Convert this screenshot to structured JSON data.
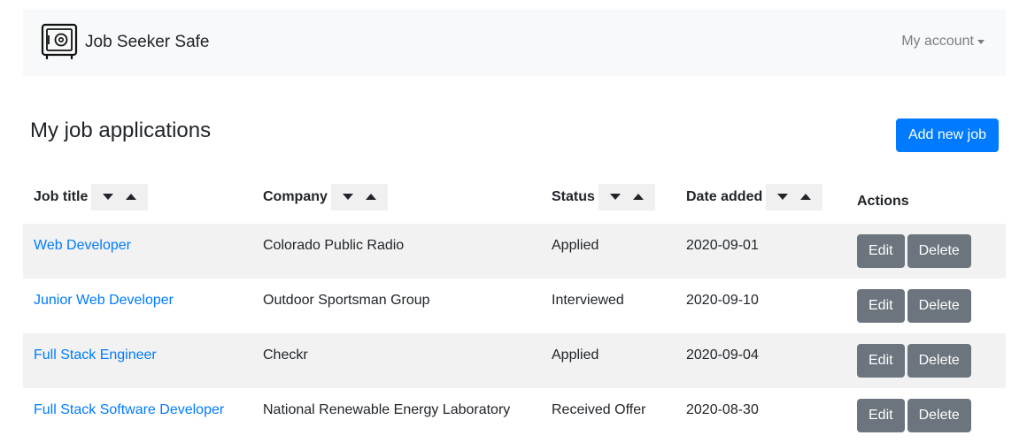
{
  "navbar": {
    "brand_name": "Job Seeker Safe",
    "brand_icon": "safe-icon",
    "account_label": "My account"
  },
  "page": {
    "title": "My job applications",
    "add_button_label": "Add new job"
  },
  "table": {
    "columns": [
      {
        "label": "Job title",
        "sortable": true
      },
      {
        "label": "Company",
        "sortable": true
      },
      {
        "label": "Status",
        "sortable": true
      },
      {
        "label": "Date added",
        "sortable": true
      },
      {
        "label": "Actions",
        "sortable": false
      }
    ],
    "sort_icons": {
      "down": "sort-down-icon",
      "up": "sort-up-icon"
    },
    "rows": [
      {
        "title": "Web Developer",
        "company": "Colorado Public Radio",
        "status": "Applied",
        "date": "2020-09-01",
        "edit": "Edit",
        "delete": "Delete"
      },
      {
        "title": "Junior Web Developer",
        "company": "Outdoor Sportsman Group",
        "status": "Interviewed",
        "date": "2020-09-10",
        "edit": "Edit",
        "delete": "Delete"
      },
      {
        "title": "Full Stack Engineer",
        "company": "Checkr",
        "status": "Applied",
        "date": "2020-09-04",
        "edit": "Edit",
        "delete": "Delete"
      },
      {
        "title": "Full Stack Software Developer",
        "company": "National Renewable Energy Laboratory",
        "status": "Received Offer",
        "date": "2020-08-30",
        "edit": "Edit",
        "delete": "Delete"
      }
    ]
  },
  "colors": {
    "primary": "#007bff",
    "secondary": "#6c757d",
    "navbar_bg": "#f8f9fa",
    "stripe": "#f2f2f2"
  }
}
